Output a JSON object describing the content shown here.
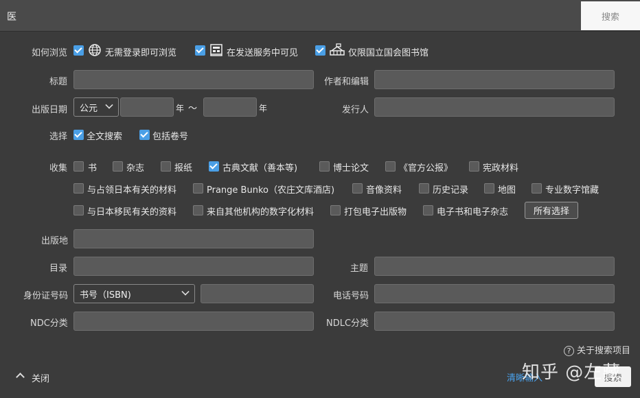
{
  "topbar": {
    "title": "医",
    "search_label": "搜索"
  },
  "browse": {
    "label": "如何浏览",
    "options": [
      {
        "label": "无需登录即可浏览",
        "checked": true,
        "icon": "globe-icon"
      },
      {
        "label": "在发送服务中可见",
        "checked": true,
        "icon": "building-icon"
      },
      {
        "label": "仅限国立国会图书馆",
        "checked": true,
        "icon": "library-icon"
      }
    ]
  },
  "fields": {
    "title_label": "标题",
    "author_label": "作者和编辑",
    "pubdate_label": "出版日期",
    "era_select": "公元",
    "year_suffix_1": "年",
    "tilde": "～",
    "year_suffix_2": "年",
    "publisher_label": "发行人",
    "pubplace_label": "出版地",
    "toc_label": "目录",
    "subject_label": "主题",
    "id_label": "身份证号码",
    "id_select": "书号（ISBN)",
    "phone_label": "电话号码",
    "ndc_label": "NDC分类",
    "ndlc_label": "NDLC分类"
  },
  "select_opts": {
    "label": "选择",
    "options": [
      {
        "label": "全文搜索",
        "checked": true
      },
      {
        "label": "包括卷号",
        "checked": true
      }
    ]
  },
  "collection": {
    "label": "收集",
    "row1": [
      {
        "label": "书",
        "checked": false
      },
      {
        "label": "杂志",
        "checked": false
      },
      {
        "label": "报纸",
        "checked": false
      },
      {
        "label": "古典文献（善本等)",
        "checked": true
      },
      {
        "label": "博士论文",
        "checked": false
      },
      {
        "label": "《官方公报》",
        "checked": false
      },
      {
        "label": "宪政材料",
        "checked": false
      }
    ],
    "row2": [
      {
        "label": "与占领日本有关的材料",
        "checked": false
      },
      {
        "label": "Prange Bunko（农庄文库酒店)",
        "checked": false
      },
      {
        "label": "音像资料",
        "checked": false
      },
      {
        "label": "历史记录",
        "checked": false
      },
      {
        "label": "地图",
        "checked": false
      },
      {
        "label": "专业数字馆藏",
        "checked": false
      }
    ],
    "row3": [
      {
        "label": "与日本移民有关的资料",
        "checked": false
      },
      {
        "label": "来自其他机构的数字化材料",
        "checked": false
      },
      {
        "label": "打包电子出版物",
        "checked": false
      },
      {
        "label": "电子书和电子杂志",
        "checked": false
      }
    ],
    "select_all": "所有选择"
  },
  "footer": {
    "close": "关闭",
    "help": "关于搜索项目",
    "clear": "清晰输入",
    "submit": "搜索",
    "watermark": "知乎 @左藏"
  }
}
